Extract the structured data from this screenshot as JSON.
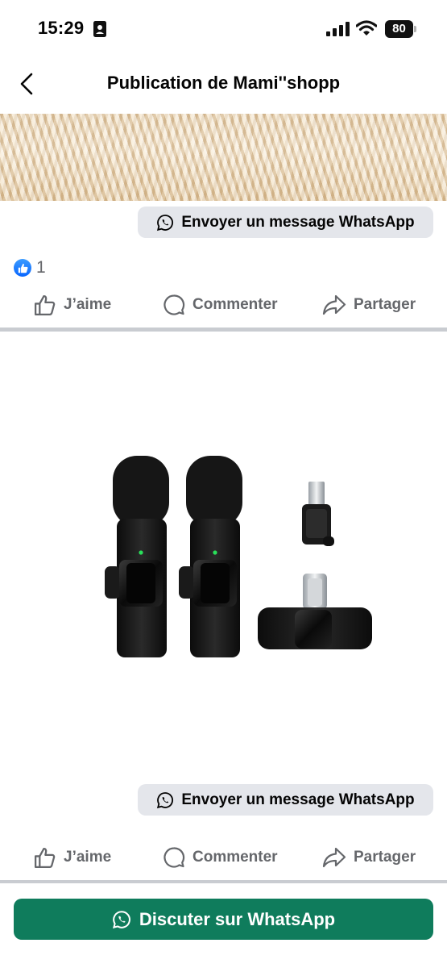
{
  "status_bar": {
    "time": "15:29",
    "battery": "80"
  },
  "header": {
    "title": "Publication de Mami''shopp"
  },
  "posts": [
    {
      "whatsapp_label": "Envoyer un message WhatsApp",
      "reaction_count": "1",
      "actions": {
        "like": "J’aime",
        "comment": "Commenter",
        "share": "Partager"
      }
    },
    {
      "whatsapp_label": "Envoyer un message WhatsApp",
      "actions": {
        "like": "J’aime",
        "comment": "Commenter",
        "share": "Partager"
      }
    }
  ],
  "footer": {
    "chat_label": "Discuter sur WhatsApp"
  },
  "colors": {
    "chat_button": "#0f7c5c",
    "like_badge": "#0866ff",
    "action_text": "#65676b",
    "pill_bg": "#e4e6eb"
  },
  "icons": [
    "id-card-icon",
    "signal-icon",
    "wifi-icon",
    "battery-icon",
    "back-icon",
    "whatsapp-icon",
    "like-icon",
    "comment-icon",
    "share-icon"
  ]
}
